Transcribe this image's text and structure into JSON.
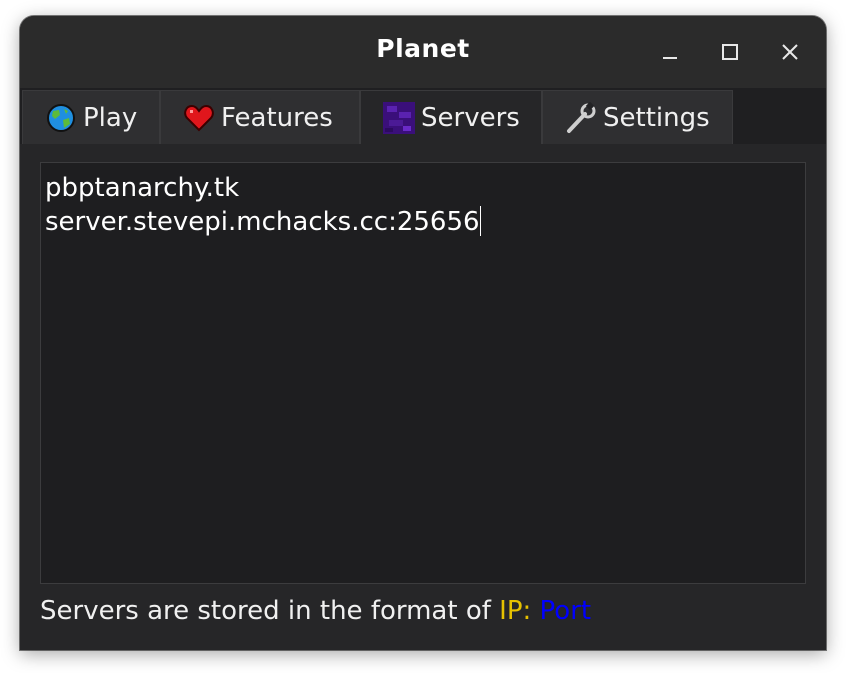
{
  "window": {
    "title": "Planet"
  },
  "tabs": [
    {
      "label": "Play",
      "icon": "globe-icon"
    },
    {
      "label": "Features",
      "icon": "heart-icon"
    },
    {
      "label": "Servers",
      "icon": "portal-icon"
    },
    {
      "label": "Settings",
      "icon": "wrench-icon"
    }
  ],
  "active_tab": "Servers",
  "servers": {
    "lines": [
      "pbptanarchy.tk",
      "server.stevepi.mchacks.cc:25656"
    ]
  },
  "hint": {
    "prefix": "Servers are stored in the format of ",
    "ip": "IP",
    "colon": ": ",
    "port": "Port",
    "ip_color": "#e6c100",
    "port_color": "#0000ff"
  }
}
